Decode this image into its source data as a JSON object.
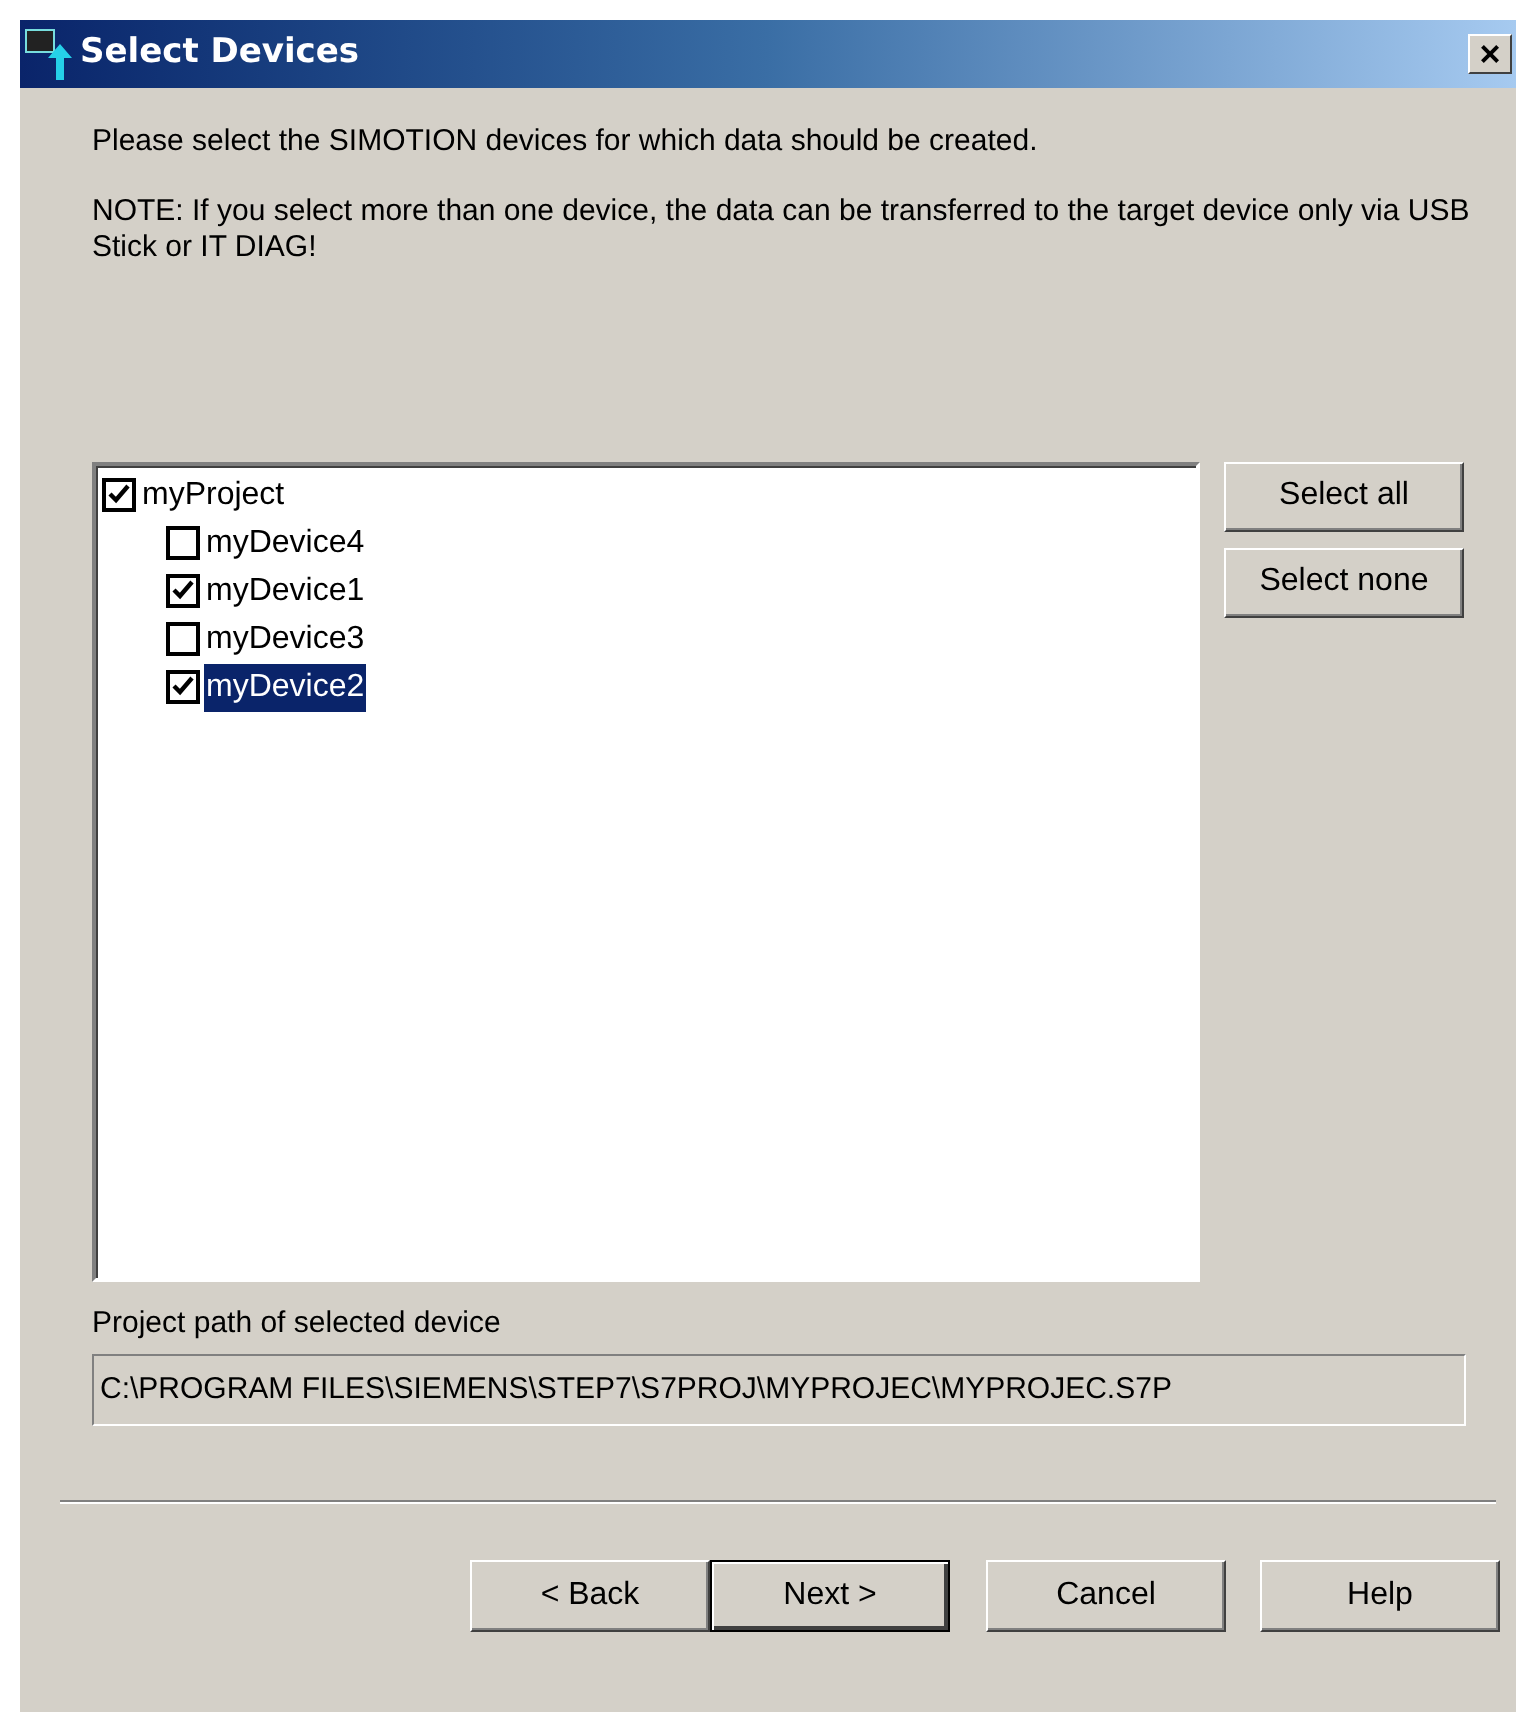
{
  "window": {
    "title": "Select Devices",
    "close": "×"
  },
  "intro": "Please select the SIMOTION devices for which data should be created.",
  "note": "NOTE: If you select more than one device, the data can be transferred to the target device only via USB Stick or IT DIAG!",
  "tree": [
    {
      "label": "myProject",
      "checked": true,
      "selected": false,
      "children": [
        {
          "label": "myDevice4",
          "checked": false,
          "selected": false
        },
        {
          "label": "myDevice1",
          "checked": true,
          "selected": false
        },
        {
          "label": "myDevice3",
          "checked": false,
          "selected": false
        },
        {
          "label": "myDevice2",
          "checked": true,
          "selected": true
        }
      ]
    }
  ],
  "side_buttons": [
    "Select all",
    "Select none"
  ],
  "path_label": "Project path of selected device",
  "path_value": "C:\\PROGRAM FILES\\SIEMENS\\STEP7\\S7PROJ\\MYPROJEC\\MYPROJEC.S7P",
  "buttons": [
    {
      "label": "< Back",
      "default": false
    },
    {
      "label": "Next >",
      "default": true
    },
    {
      "label": "Cancel",
      "default": false
    },
    {
      "label": "Help",
      "default": false
    }
  ]
}
